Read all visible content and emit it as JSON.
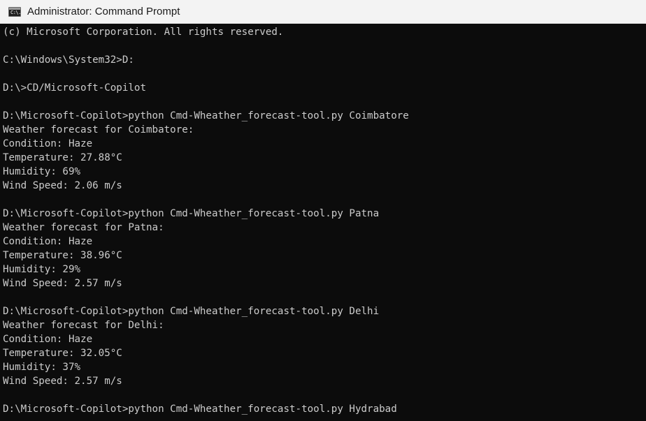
{
  "window": {
    "title": "Administrator: Command Prompt",
    "icon": "cmd-icon",
    "icon_glyph": "C:\\."
  },
  "console": {
    "lines": [
      "(c) Microsoft Corporation. All rights reserved.",
      "",
      "C:\\Windows\\System32>D:",
      "",
      "D:\\>CD/Microsoft-Copilot",
      "",
      "D:\\Microsoft-Copilot>python Cmd-Wheather_forecast-tool.py Coimbatore",
      "Weather forecast for Coimbatore:",
      "Condition: Haze",
      "Temperature: 27.88°C",
      "Humidity: 69%",
      "Wind Speed: 2.06 m/s",
      "",
      "D:\\Microsoft-Copilot>python Cmd-Wheather_forecast-tool.py Patna",
      "Weather forecast for Patna:",
      "Condition: Haze",
      "Temperature: 38.96°C",
      "Humidity: 29%",
      "Wind Speed: 2.57 m/s",
      "",
      "D:\\Microsoft-Copilot>python Cmd-Wheather_forecast-tool.py Delhi",
      "Weather forecast for Delhi:",
      "Condition: Haze",
      "Temperature: 32.05°C",
      "Humidity: 37%",
      "Wind Speed: 2.57 m/s",
      "",
      "D:\\Microsoft-Copilot>python Cmd-Wheather_forecast-tool.py Hydrabad"
    ]
  },
  "colors": {
    "console_bg": "#0c0c0c",
    "console_text": "#cccccc",
    "titlebar_bg": "#f3f3f3"
  }
}
